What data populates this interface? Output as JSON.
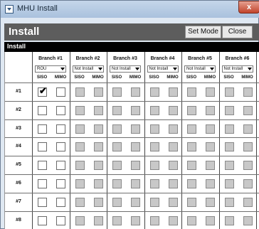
{
  "window": {
    "title": "MHU Install",
    "close_glyph": "x",
    "icon": "app-window-icon"
  },
  "header": {
    "title": "Install",
    "set_mode_label": "Set Mode",
    "close_label": "Close"
  },
  "section": {
    "title": "Install"
  },
  "sub_columns": [
    "SISO",
    "MIMO"
  ],
  "branches": [
    {
      "name": "Branch #1",
      "selected": "ROU"
    },
    {
      "name": "Branch #2",
      "selected": "Not Install"
    },
    {
      "name": "Branch #3",
      "selected": "Not Install"
    },
    {
      "name": "Branch #4",
      "selected": "Not Install"
    },
    {
      "name": "Branch #5",
      "selected": "Not Install"
    },
    {
      "name": "Branch #6",
      "selected": "Not Install"
    }
  ],
  "rows": [
    "#1",
    "#2",
    "#3",
    "#4",
    "#5",
    "#6",
    "#7",
    "#8"
  ],
  "checked": [
    {
      "row": "#1",
      "branch": "Branch #1",
      "column": "SISO"
    }
  ]
}
